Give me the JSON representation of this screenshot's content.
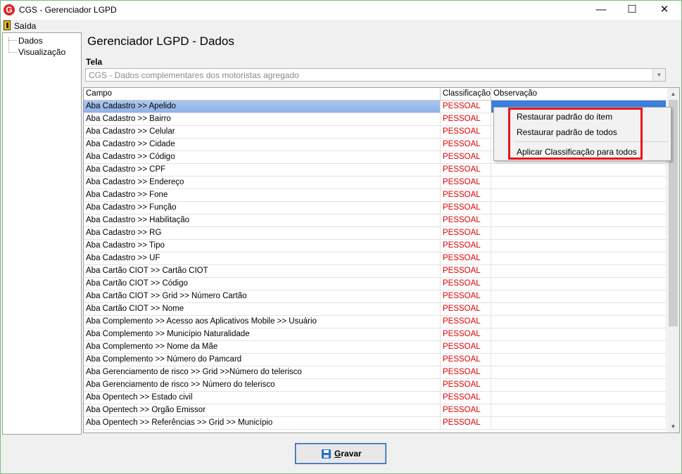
{
  "window": {
    "title": "CGS - Gerenciador LGPD",
    "app_icon": "G",
    "minimize": "—",
    "maximize": "☐",
    "close": "✕"
  },
  "menu": {
    "exit_label": "Saída"
  },
  "tree": {
    "items": [
      "Dados",
      "Visualização"
    ]
  },
  "page_title": "Gerenciador LGPD - Dados",
  "tela": {
    "label": "Tela",
    "value": "CGS - Dados complementares dos motoristas agregado",
    "arrow": "▼"
  },
  "grid": {
    "columns": [
      "Campo",
      "Classificação",
      "Observação"
    ],
    "selected_index": 0,
    "rows": [
      {
        "campo": "Aba Cadastro >> Apelido",
        "classificacao": "PESSOAL",
        "observacao": ""
      },
      {
        "campo": "Aba Cadastro >> Bairro",
        "classificacao": "PESSOAL",
        "observacao": ""
      },
      {
        "campo": "Aba Cadastro >> Celular",
        "classificacao": "PESSOAL",
        "observacao": ""
      },
      {
        "campo": "Aba Cadastro >> Cidade",
        "classificacao": "PESSOAL",
        "observacao": ""
      },
      {
        "campo": "Aba Cadastro >> Código",
        "classificacao": "PESSOAL",
        "observacao": ""
      },
      {
        "campo": "Aba Cadastro >> CPF",
        "classificacao": "PESSOAL",
        "observacao": ""
      },
      {
        "campo": "Aba Cadastro >> Endereço",
        "classificacao": "PESSOAL",
        "observacao": ""
      },
      {
        "campo": "Aba Cadastro >> Fone",
        "classificacao": "PESSOAL",
        "observacao": ""
      },
      {
        "campo": "Aba Cadastro >> Função",
        "classificacao": "PESSOAL",
        "observacao": ""
      },
      {
        "campo": "Aba Cadastro >> Habilitação",
        "classificacao": "PESSOAL",
        "observacao": ""
      },
      {
        "campo": "Aba Cadastro >> RG",
        "classificacao": "PESSOAL",
        "observacao": ""
      },
      {
        "campo": "Aba Cadastro >> Tipo",
        "classificacao": "PESSOAL",
        "observacao": ""
      },
      {
        "campo": "Aba Cadastro >> UF",
        "classificacao": "PESSOAL",
        "observacao": ""
      },
      {
        "campo": "Aba Cartão CIOT >> Cartão CIOT",
        "classificacao": "PESSOAL",
        "observacao": ""
      },
      {
        "campo": "Aba Cartão CIOT >> Código",
        "classificacao": "PESSOAL",
        "observacao": ""
      },
      {
        "campo": "Aba Cartão CIOT >> Grid >> Número Cartão",
        "classificacao": "PESSOAL",
        "observacao": ""
      },
      {
        "campo": "Aba Cartão CIOT >> Nome",
        "classificacao": "PESSOAL",
        "observacao": ""
      },
      {
        "campo": "Aba Complemento >> Acesso aos Aplicativos Mobile >> Usuário",
        "classificacao": "PESSOAL",
        "observacao": ""
      },
      {
        "campo": "Aba Complemento >> Município Naturalidade",
        "classificacao": "PESSOAL",
        "observacao": ""
      },
      {
        "campo": "Aba Complemento >> Nome da Mãe",
        "classificacao": "PESSOAL",
        "observacao": ""
      },
      {
        "campo": "Aba Complemento >> Número do Pamcard",
        "classificacao": "PESSOAL",
        "observacao": ""
      },
      {
        "campo": "Aba Gerenciamento de risco >> Grid >>Número do telerisco",
        "classificacao": "PESSOAL",
        "observacao": ""
      },
      {
        "campo": "Aba Gerenciamento de risco >> Número do telerisco",
        "classificacao": "PESSOAL",
        "observacao": ""
      },
      {
        "campo": "Aba Opentech >> Estado civil",
        "classificacao": "PESSOAL",
        "observacao": ""
      },
      {
        "campo": "Aba Opentech >> Orgão Emissor",
        "classificacao": "PESSOAL",
        "observacao": ""
      },
      {
        "campo": "Aba Opentech >> Referências >> Grid >> Município",
        "classificacao": "PESSOAL",
        "observacao": ""
      }
    ]
  },
  "context_menu": {
    "items": [
      "Restaurar padrão do item",
      "Restaurar padrão de todos",
      "Aplicar Classificação para todos"
    ]
  },
  "save_button": {
    "label_underlined": "G",
    "label_rest": "ravar"
  },
  "colors": {
    "classification_text": "#e00000",
    "selection": "#3a7ee0",
    "highlight_box": "#e8141c",
    "window_border": "#7fba82"
  }
}
